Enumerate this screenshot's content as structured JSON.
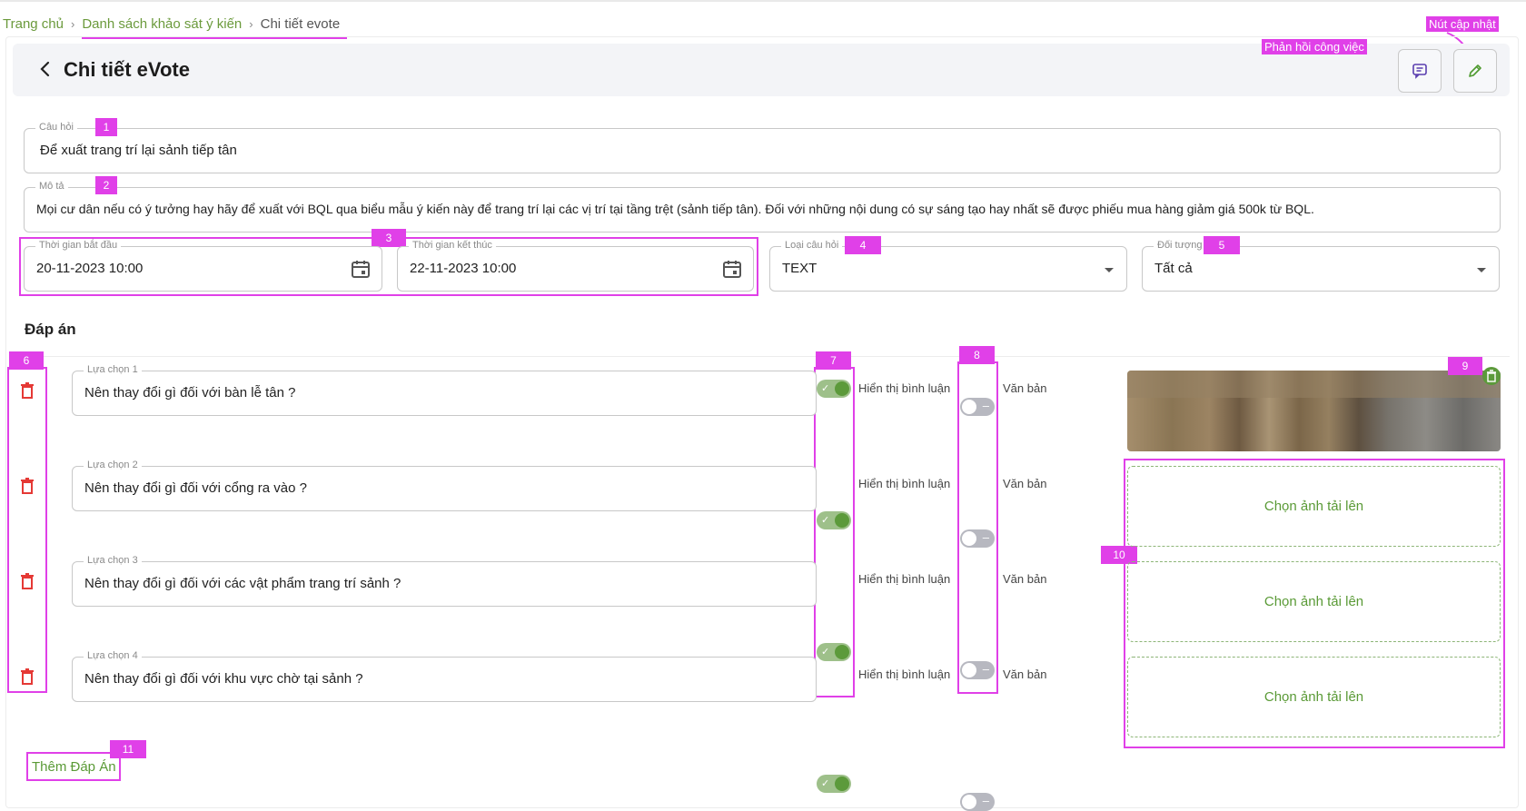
{
  "breadcrumb": {
    "home": "Trang chủ",
    "list": "Danh sách khảo sát ý kiến",
    "current": "Chi tiết evote",
    "separator": "›"
  },
  "header": {
    "title": "Chi tiết eVote",
    "feedback_annotation": "Phản hồi công việc",
    "update_annotation": "Nút cập nhật"
  },
  "form": {
    "question": {
      "label": "Câu hỏi",
      "value": "Để xuất trang trí lại sảnh tiếp tân"
    },
    "description": {
      "label": "Mô tả",
      "value": "Mọi cư dân nếu có ý tưởng hay hãy để xuất với BQL qua biểu mẫu ý kiến này để trang trí lại các vị trí tại tầng trệt (sảnh tiếp tân). Đối với những nội dung có sự sáng tạo hay nhất sẽ được phiếu mua hàng giảm giá 500k từ BQL."
    },
    "start_time": {
      "label": "Thời gian bắt đầu",
      "value": "20-11-2023 10:00"
    },
    "end_time": {
      "label": "Thời gian kết thúc",
      "value": "22-11-2023 10:00"
    },
    "question_type": {
      "label": "Loại câu hỏi",
      "value": "TEXT"
    },
    "audience": {
      "label": "Đối tượng",
      "value": "Tất cả"
    }
  },
  "answers": {
    "section_title": "Đáp án",
    "comment_toggle_label": "Hiển thị bình luận",
    "text_toggle_label": "Văn bản",
    "items": [
      {
        "label": "Lựa chọn 1",
        "value": "Nên thay đổi gì đối với bàn lễ tân ?",
        "show_comments": true,
        "text": false
      },
      {
        "label": "Lựa chọn 2",
        "value": "Nên thay đổi gì đối với cổng ra vào ?",
        "show_comments": true,
        "text": false
      },
      {
        "label": "Lựa chọn 3",
        "value": "Nên thay đổi gì đối với các vật phẩm trang trí sảnh ?",
        "show_comments": true,
        "text": false
      },
      {
        "label": "Lựa chọn 4",
        "value": "Nên thay đổi gì đối với khu vực chờ tại sảnh ?",
        "show_comments": true,
        "text": false
      }
    ],
    "upload_label": "Chọn ảnh tải lên",
    "add_answer": "Thêm Đáp Án"
  },
  "badges": [
    "1",
    "2",
    "3",
    "4",
    "5",
    "6",
    "7",
    "8",
    "9",
    "10",
    "11"
  ],
  "colors": {
    "accent_green": "#5c9a3b",
    "annotation_magenta": "#e040e8",
    "delete_red": "#e53935"
  }
}
